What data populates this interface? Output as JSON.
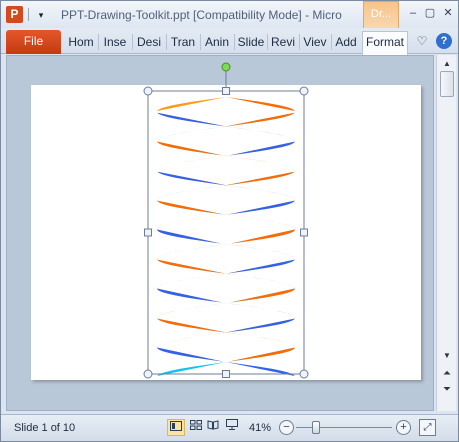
{
  "window": {
    "title": "PPT-Drawing-Toolkit.ppt [Compatibility Mode]  -  Micro",
    "app_icon": "P",
    "context_tab_label": "Dr...",
    "qat_dropdown_glyph": "▾",
    "controls": {
      "minimize": "–",
      "maximize": "▢",
      "close": "✕"
    }
  },
  "ribbon": {
    "file_label": "File",
    "tabs": [
      "Hom",
      "Inse",
      "Desi",
      "Tran",
      "Anin",
      "Slide",
      "Revi",
      "Viev",
      "Add",
      "Format"
    ],
    "icons": {
      "minimize_ribbon": "chevron-up-icon",
      "help": "help-icon"
    },
    "help_glyph": "?",
    "heart_glyph": "♡"
  },
  "scrollbar": {
    "up": "▲",
    "down": "▼",
    "prev_slide": "⏶",
    "next_slide": "⏷"
  },
  "helix": {
    "colors": {
      "cyan": "#13c3ef",
      "orange": "#ff6a00",
      "blue": "#2f63ef",
      "amber": "#ff9a18"
    }
  },
  "status": {
    "slide_indicator": "Slide 1 of 10",
    "zoom_level": "41%",
    "zoom_minus": "−",
    "zoom_plus": "+",
    "fit_glyph": "⤢",
    "zoom_fraction": 0.18
  }
}
